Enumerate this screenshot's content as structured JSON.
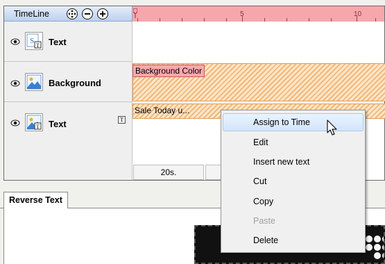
{
  "timeline": {
    "title": "TimeLine",
    "header_icons": [
      "move-icon",
      "zoom-out-icon",
      "zoom-in-icon"
    ],
    "ruler_labels": [
      "5",
      "10"
    ],
    "colors": {
      "ruler": "#f7a7ac",
      "clip_fill": "#fde6c8",
      "clip_label": "#f9a8ab"
    }
  },
  "layers": [
    {
      "label": "Text",
      "icon": "text-layer-icon",
      "visibility_icon": "eye-icon"
    },
    {
      "label": "Background",
      "icon": "image-layer-icon",
      "visibility_icon": "eye-icon"
    },
    {
      "label": "Text",
      "icon": "image-text-layer-icon",
      "visibility_icon": "eye-icon",
      "flag_icon": "text-type-icon"
    }
  ],
  "clips": {
    "background": "Background Color",
    "text": "Sale Today u..."
  },
  "time_cell": "20s.",
  "bottom_panel": {
    "tab_label": "Reverse Text"
  },
  "context_menu": {
    "items": [
      {
        "label": "Assign to Time",
        "state": "highlighted"
      },
      {
        "label": "Edit",
        "state": "normal"
      },
      {
        "label": "Insert new text",
        "state": "normal"
      },
      {
        "label": "Cut",
        "state": "normal"
      },
      {
        "label": "Copy",
        "state": "normal"
      },
      {
        "label": "Paste",
        "state": "disabled"
      },
      {
        "label": "Delete",
        "state": "normal"
      }
    ]
  }
}
